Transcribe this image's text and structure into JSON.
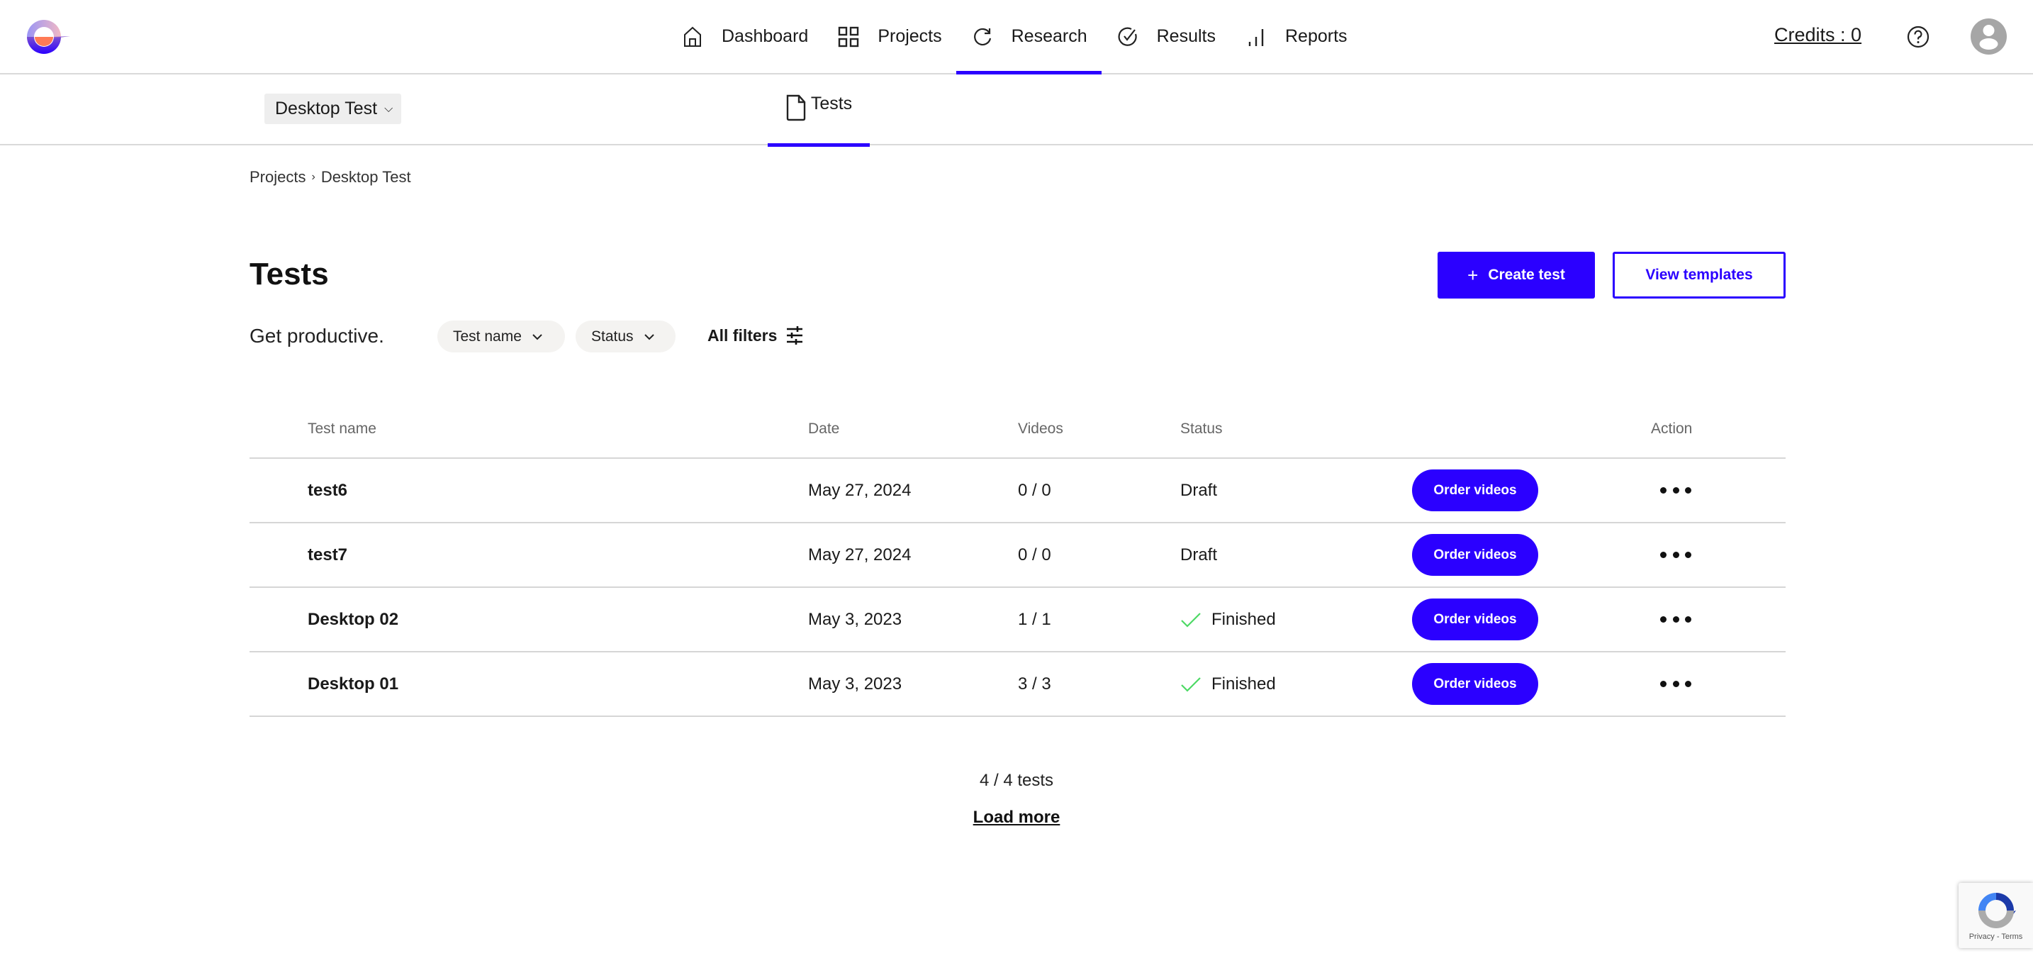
{
  "header": {
    "logo": "app-logo",
    "nav": [
      {
        "label": "Dashboard",
        "icon": "home-icon",
        "active": false
      },
      {
        "label": "Projects",
        "icon": "grid-icon",
        "active": false
      },
      {
        "label": "Research",
        "icon": "refresh-icon",
        "active": true
      },
      {
        "label": "Results",
        "icon": "check-circle-icon",
        "active": false
      },
      {
        "label": "Reports",
        "icon": "bar-chart-icon",
        "active": false
      }
    ],
    "credits_label": "Credits : 0",
    "help_icon": "help-icon",
    "avatar_icon": "user-avatar-icon"
  },
  "subheader": {
    "project_select": "Desktop Test",
    "tab_label": "Tests"
  },
  "breadcrumb": {
    "items": [
      "Projects",
      "Desktop Test"
    ],
    "separator": "›"
  },
  "page": {
    "title": "Tests",
    "subtitle": "Get productive.",
    "create_button": "Create test",
    "create_icon": "+",
    "templates_button": "View templates",
    "filters": {
      "test_name": "Test name",
      "status": "Status",
      "all_filters": "All filters"
    }
  },
  "table": {
    "columns": [
      "Test name",
      "Date",
      "Videos",
      "Status",
      "Action"
    ],
    "rows": [
      {
        "name": "test6",
        "date": "May 27, 2024",
        "videos": "0 / 0",
        "status": "Draft",
        "finished": false,
        "order_label": "Order videos"
      },
      {
        "name": "test7",
        "date": "May 27, 2024",
        "videos": "0 / 0",
        "status": "Draft",
        "finished": false,
        "order_label": "Order videos"
      },
      {
        "name": "Desktop 02",
        "date": "May 3, 2023",
        "videos": "1 / 1",
        "status": "Finished",
        "finished": true,
        "order_label": "Order videos"
      },
      {
        "name": "Desktop 01",
        "date": "May 3, 2023",
        "videos": "3 / 3",
        "status": "Finished",
        "finished": true,
        "order_label": "Order videos"
      }
    ]
  },
  "footer": {
    "count": "4 / 4 tests",
    "load_more": "Load more"
  },
  "recaptcha": {
    "links": "Privacy - Terms"
  },
  "colors": {
    "accent": "#2b00ff",
    "success": "#4cd964",
    "divider": "#d6d6d6",
    "chip_bg": "#f4f3f1"
  }
}
